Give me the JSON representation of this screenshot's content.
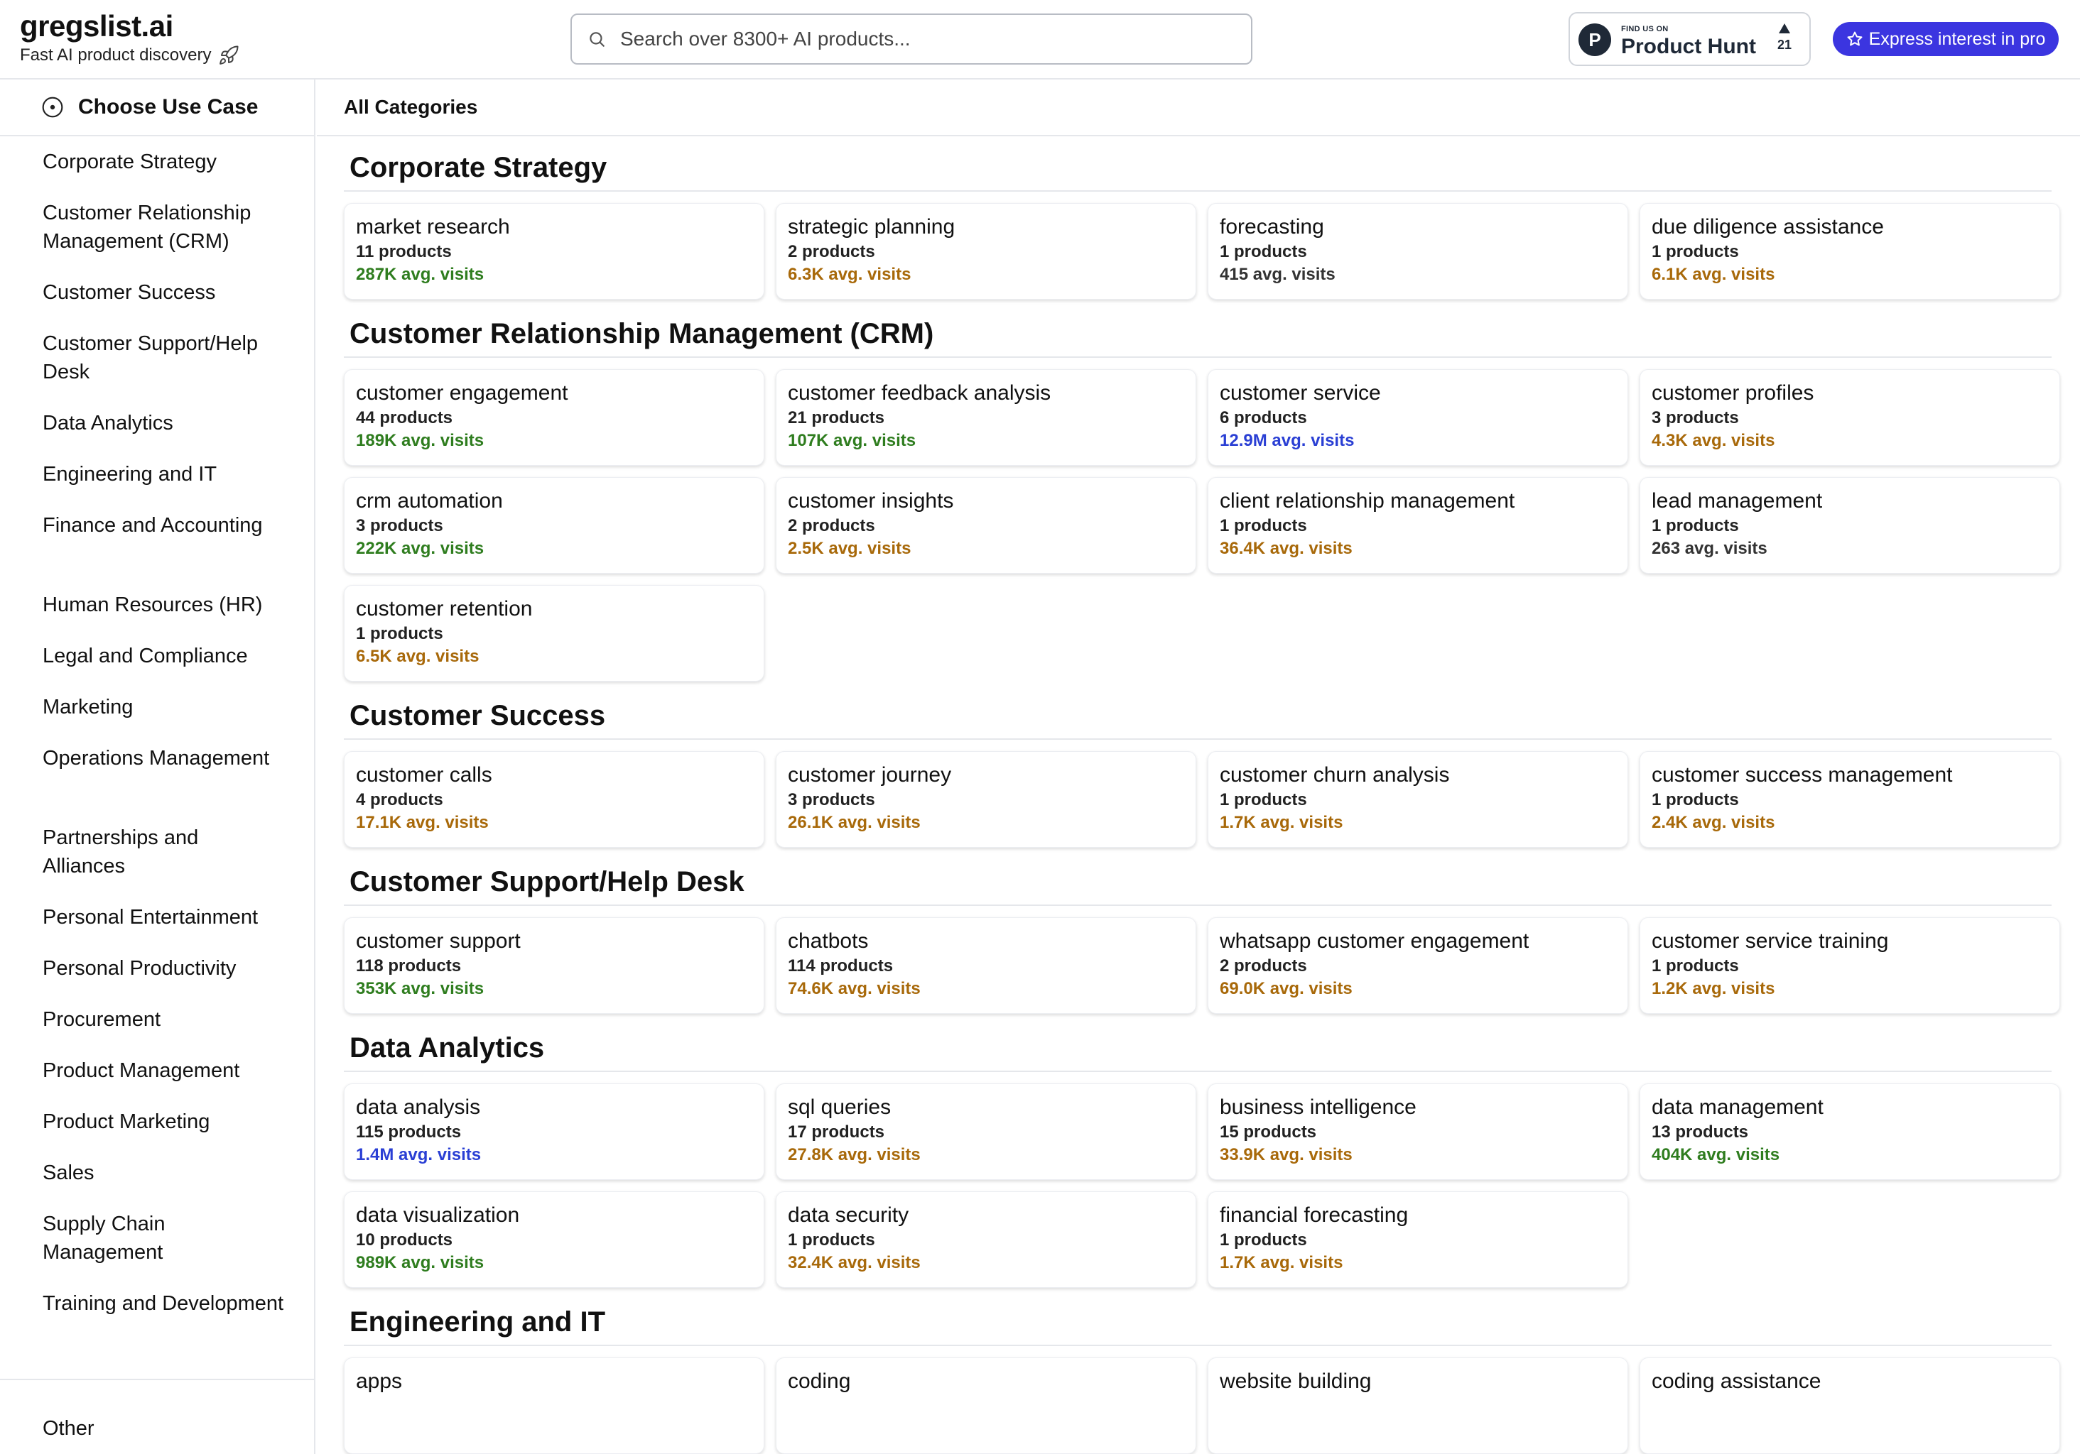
{
  "header": {
    "brand_name": "gregslist.ai",
    "tagline": "Fast AI product discovery",
    "tagline_icon": "rocket-icon",
    "search_placeholder": "Search over 8300+ AI products...",
    "product_hunt": {
      "small_text": "FIND US ON",
      "name": "Product Hunt",
      "logo_letter": "P",
      "upvotes": "21"
    },
    "pro_button": "Express interest in pro",
    "accent_color": "#3b35e0"
  },
  "sidebar": {
    "use_case_label": "Choose Use Case",
    "items": [
      {
        "label": "Corporate Strategy"
      },
      {
        "label": "Customer Relationship Management (CRM)"
      },
      {
        "label": "Customer Success"
      },
      {
        "label": "Customer Support/Help Desk"
      },
      {
        "label": "Data Analytics"
      },
      {
        "label": "Engineering and IT"
      },
      {
        "label": "Finance and Accounting"
      },
      {
        "label": "Human Resources (HR)"
      },
      {
        "label": "Legal and Compliance"
      },
      {
        "label": "Marketing"
      },
      {
        "label": "Operations Management"
      },
      {
        "label": "Partnerships and Alliances"
      },
      {
        "label": "Personal Entertainment"
      },
      {
        "label": "Personal Productivity"
      },
      {
        "label": "Procurement"
      },
      {
        "label": "Product Management"
      },
      {
        "label": "Product Marketing"
      },
      {
        "label": "Sales"
      },
      {
        "label": "Supply Chain Management"
      },
      {
        "label": "Training and Development"
      }
    ],
    "other_label": "Other"
  },
  "main": {
    "heading": "All Categories",
    "visit_colors": {
      "green": "#2f7d1f",
      "orange": "#a8690a",
      "blue": "#2a3fd4",
      "gray": "#333333"
    },
    "sections": [
      {
        "title": "Corporate Strategy",
        "cards": [
          {
            "title": "market research",
            "count": "11 products",
            "visits": "287K avg. visits",
            "tier": "green"
          },
          {
            "title": "strategic planning",
            "count": "2 products",
            "visits": "6.3K avg. visits",
            "tier": "orange"
          },
          {
            "title": "forecasting",
            "count": "1 products",
            "visits": "415 avg. visits",
            "tier": "gray"
          },
          {
            "title": "due diligence assistance",
            "count": "1 products",
            "visits": "6.1K avg. visits",
            "tier": "orange"
          }
        ]
      },
      {
        "title": "Customer Relationship Management (CRM)",
        "cards": [
          {
            "title": "customer engagement",
            "count": "44 products",
            "visits": "189K avg. visits",
            "tier": "green"
          },
          {
            "title": "customer feedback analysis",
            "count": "21 products",
            "visits": "107K avg. visits",
            "tier": "green"
          },
          {
            "title": "customer service",
            "count": "6 products",
            "visits": "12.9M avg. visits",
            "tier": "blue"
          },
          {
            "title": "customer profiles",
            "count": "3 products",
            "visits": "4.3K avg. visits",
            "tier": "orange"
          },
          {
            "title": "crm automation",
            "count": "3 products",
            "visits": "222K avg. visits",
            "tier": "green"
          },
          {
            "title": "customer insights",
            "count": "2 products",
            "visits": "2.5K avg. visits",
            "tier": "orange"
          },
          {
            "title": "client relationship management",
            "count": "1 products",
            "visits": "36.4K avg. visits",
            "tier": "orange"
          },
          {
            "title": "lead management",
            "count": "1 products",
            "visits": "263 avg. visits",
            "tier": "gray"
          },
          {
            "title": "customer retention",
            "count": "1 products",
            "visits": "6.5K avg. visits",
            "tier": "orange"
          }
        ]
      },
      {
        "title": "Customer Success",
        "cards": [
          {
            "title": "customer calls",
            "count": "4 products",
            "visits": "17.1K avg. visits",
            "tier": "orange"
          },
          {
            "title": "customer journey",
            "count": "3 products",
            "visits": "26.1K avg. visits",
            "tier": "orange"
          },
          {
            "title": "customer churn analysis",
            "count": "1 products",
            "visits": "1.7K avg. visits",
            "tier": "orange"
          },
          {
            "title": "customer success management",
            "count": "1 products",
            "visits": "2.4K avg. visits",
            "tier": "orange"
          }
        ]
      },
      {
        "title": "Customer Support/Help Desk",
        "cards": [
          {
            "title": "customer support",
            "count": "118 products",
            "visits": "353K avg. visits",
            "tier": "green"
          },
          {
            "title": "chatbots",
            "count": "114 products",
            "visits": "74.6K avg. visits",
            "tier": "orange"
          },
          {
            "title": "whatsapp customer engagement",
            "count": "2 products",
            "visits": "69.0K avg. visits",
            "tier": "orange"
          },
          {
            "title": "customer service training",
            "count": "1 products",
            "visits": "1.2K avg. visits",
            "tier": "orange"
          }
        ]
      },
      {
        "title": "Data Analytics",
        "cards": [
          {
            "title": "data analysis",
            "count": "115 products",
            "visits": "1.4M avg. visits",
            "tier": "blue"
          },
          {
            "title": "sql queries",
            "count": "17 products",
            "visits": "27.8K avg. visits",
            "tier": "orange"
          },
          {
            "title": "business intelligence",
            "count": "15 products",
            "visits": "33.9K avg. visits",
            "tier": "orange"
          },
          {
            "title": "data management",
            "count": "13 products",
            "visits": "404K avg. visits",
            "tier": "green"
          },
          {
            "title": "data visualization",
            "count": "10 products",
            "visits": "989K avg. visits",
            "tier": "green"
          },
          {
            "title": "data security",
            "count": "1 products",
            "visits": "32.4K avg. visits",
            "tier": "orange"
          },
          {
            "title": "financial forecasting",
            "count": "1 products",
            "visits": "1.7K avg. visits",
            "tier": "orange"
          }
        ]
      },
      {
        "title": "Engineering and IT",
        "cards": [
          {
            "title": "apps",
            "count": "",
            "visits": "",
            "tier": "gray"
          },
          {
            "title": "coding",
            "count": "",
            "visits": "",
            "tier": "gray"
          },
          {
            "title": "website building",
            "count": "",
            "visits": "",
            "tier": "gray"
          },
          {
            "title": "coding assistance",
            "count": "",
            "visits": "",
            "tier": "gray"
          }
        ]
      }
    ]
  }
}
